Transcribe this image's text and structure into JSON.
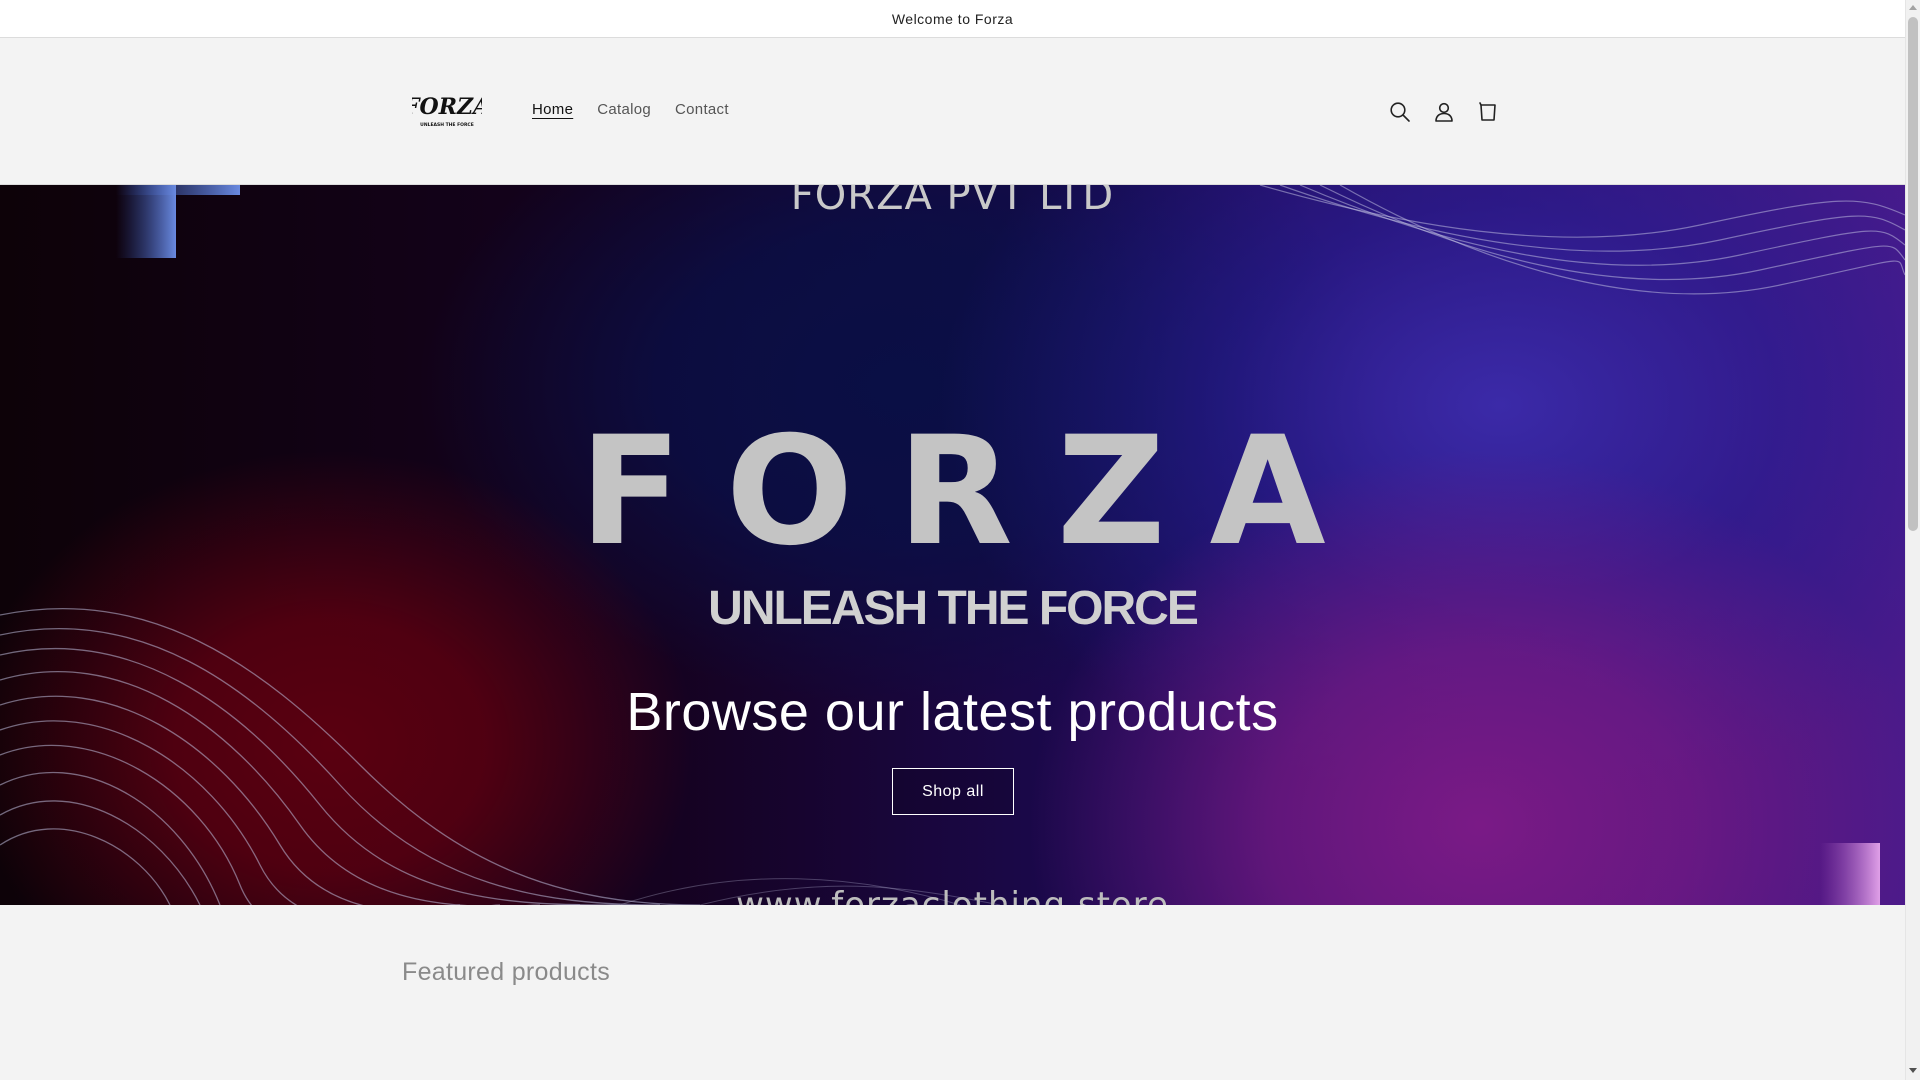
{
  "announcement": {
    "text": "Welcome to Forza"
  },
  "header": {
    "logo": {
      "text": "FORZA",
      "subtext": "UNLEASH THE FORCE"
    },
    "nav": [
      {
        "label": "Home",
        "active": true
      },
      {
        "label": "Catalog",
        "active": false
      },
      {
        "label": "Contact",
        "active": false
      }
    ],
    "icons": [
      "search-icon",
      "account-icon",
      "cart-icon"
    ]
  },
  "hero": {
    "top_text": "FORZA PVT LTD",
    "brand": "FORZA",
    "tagline": "UNLEASH THE FORCE",
    "heading": "Browse our latest products",
    "button_label": "Shop all",
    "url_text": "www.forzaclothing.store"
  },
  "featured": {
    "title": "Featured products"
  },
  "colors": {
    "background": "#f3f3f3",
    "announcement_bg": "#ffffff",
    "hero_red": "#5a0010",
    "hero_purple": "#7a1a86",
    "hero_blue": "#3b2aa8",
    "text_dark": "#121212",
    "muted": "#8a8a8a"
  }
}
